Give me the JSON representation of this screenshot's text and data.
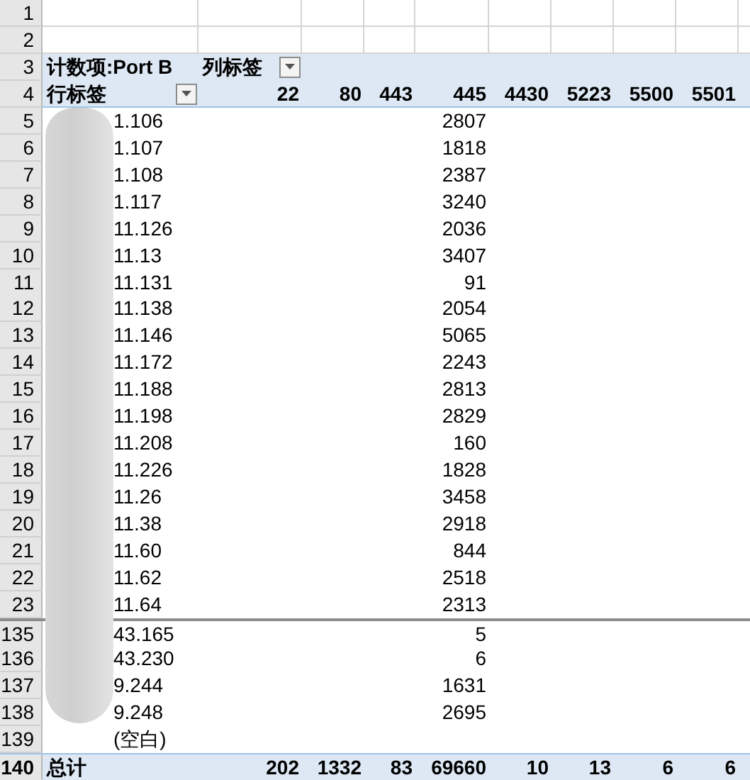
{
  "sheet": {
    "rows": [
      {
        "kind": "blank",
        "row_number": "1"
      },
      {
        "kind": "blank",
        "row_number": "2"
      },
      {
        "kind": "field_header",
        "row_number": "3",
        "value_field": "计数项:Port B",
        "column_labels": "列标签"
      },
      {
        "kind": "column_header",
        "row_number": "4",
        "row_labels": "行标签",
        "columns": [
          "22",
          "80",
          "443",
          "445",
          "4430",
          "5223",
          "5500",
          "5501"
        ]
      },
      {
        "kind": "item",
        "row_number": "5",
        "label": "1.106",
        "values": {
          "col_4": "2807"
        }
      },
      {
        "kind": "item",
        "row_number": "6",
        "label": "1.107",
        "values": {
          "col_4": "1818"
        }
      },
      {
        "kind": "item",
        "row_number": "7",
        "label": "1.108",
        "values": {
          "col_4": "2387"
        }
      },
      {
        "kind": "item",
        "row_number": "8",
        "label": "1.117",
        "values": {
          "col_4": "3240"
        }
      },
      {
        "kind": "item",
        "row_number": "9",
        "label": "11.126",
        "values": {
          "col_4": "2036"
        }
      },
      {
        "kind": "item",
        "row_number": "10",
        "label": "11.13",
        "values": {
          "col_4": "3407"
        }
      },
      {
        "kind": "item",
        "row_number": "11",
        "label": "11.131",
        "values": {
          "col_4": "91"
        }
      },
      {
        "kind": "item",
        "row_number": "12",
        "label": "11.138",
        "values": {
          "col_4": "2054"
        }
      },
      {
        "kind": "item",
        "row_number": "13",
        "label": "11.146",
        "values": {
          "col_4": "5065"
        }
      },
      {
        "kind": "item",
        "row_number": "14",
        "label": "11.172",
        "values": {
          "col_4": "2243"
        }
      },
      {
        "kind": "item",
        "row_number": "15",
        "label": "11.188",
        "values": {
          "col_4": "2813"
        }
      },
      {
        "kind": "item",
        "row_number": "16",
        "label": "11.198",
        "values": {
          "col_4": "2829"
        }
      },
      {
        "kind": "item",
        "row_number": "17",
        "label": "11.208",
        "values": {
          "col_4": "160"
        }
      },
      {
        "kind": "item",
        "row_number": "18",
        "label": "11.226",
        "values": {
          "col_4": "1828"
        }
      },
      {
        "kind": "item",
        "row_number": "19",
        "label": "11.26",
        "values": {
          "col_4": "3458"
        }
      },
      {
        "kind": "item",
        "row_number": "20",
        "label": "11.38",
        "values": {
          "col_4": "2918"
        }
      },
      {
        "kind": "item",
        "row_number": "21",
        "label": "11.60",
        "values": {
          "col_4": "844"
        }
      },
      {
        "kind": "item",
        "row_number": "22",
        "label": "11.62",
        "values": {
          "col_4": "2518"
        }
      },
      {
        "kind": "item",
        "row_number": "23",
        "label": "11.64",
        "values": {
          "col_4": "2313"
        }
      },
      {
        "kind": "item",
        "row_number": "135",
        "label": "43.165",
        "break_before": true,
        "values": {
          "col_4": "5"
        }
      },
      {
        "kind": "item",
        "row_number": "136",
        "label": "43.230",
        "values": {
          "col_4": "6"
        }
      },
      {
        "kind": "item",
        "row_number": "137",
        "label": "9.244",
        "values": {
          "col_4": "1631"
        }
      },
      {
        "kind": "item",
        "row_number": "138",
        "label": "9.248",
        "values": {
          "col_4": "2695"
        }
      },
      {
        "kind": "item",
        "row_number": "139",
        "label": "(空白)"
      },
      {
        "kind": "total",
        "row_number": "140",
        "label": "总计",
        "values": {
          "col_1": "202",
          "col_2": "1332",
          "col_3": "83",
          "col_4": "69660",
          "col_5": "10",
          "col_6": "13",
          "col_7": "6",
          "col_8": "6"
        }
      }
    ]
  }
}
